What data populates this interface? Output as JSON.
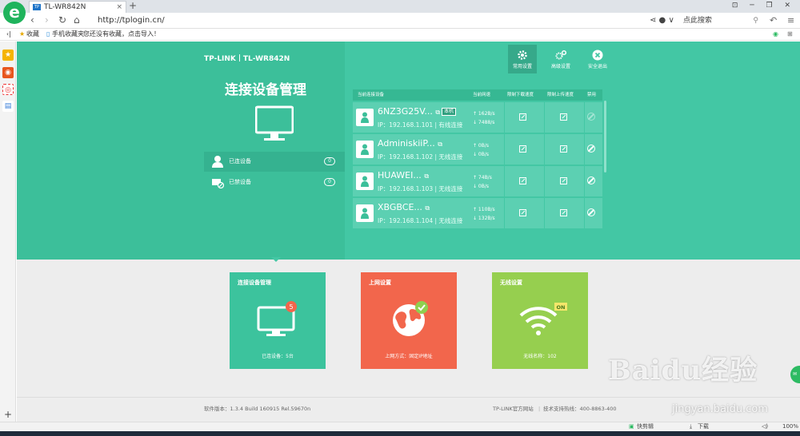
{
  "browser": {
    "tab_title": "TL-WR842N",
    "tab_favicon": "TP",
    "url": "http://tplogin.cn/",
    "search_placeholder": "点此搜索",
    "bookmarks": {
      "favorites": "收藏",
      "mobile": "手机收藏夹",
      "import_hint": "您还没有收藏，点击导入！"
    }
  },
  "router": {
    "brand": "TP-LINK",
    "model": "TL-WR842N",
    "page_title": "连接设备管理",
    "top_nav": [
      {
        "label": "常用设置",
        "icon": "gear-icon"
      },
      {
        "label": "高级设置",
        "icon": "gears-icon"
      },
      {
        "label": "安全退出",
        "icon": "exit-icon"
      }
    ],
    "menu": [
      {
        "label": "已连设备",
        "count": "0"
      },
      {
        "label": "已禁设备",
        "count": "0"
      }
    ],
    "table": {
      "headers": [
        "当前连接设备",
        "当前网速",
        "限制下载速度",
        "限制上传速度",
        "禁用"
      ],
      "rows": [
        {
          "name": "6NZ3G25V...",
          "badge": "本机",
          "ip": "IP：192.168.1.101 | 有线连接",
          "up": "↑ 162B/s",
          "down": "↓ 7488/s"
        },
        {
          "name": "AdminiskiiP...",
          "badge": "",
          "ip": "IP：192.168.1.102 | 无线连接",
          "up": "↑ 0B/s",
          "down": "↓ 0B/s"
        },
        {
          "name": "HUAWEI...",
          "badge": "",
          "ip": "IP：192.168.1.103 | 无线连接",
          "up": "↑ 74B/s",
          "down": "↓ 0B/s"
        },
        {
          "name": "XBGBCE...",
          "badge": "",
          "ip": "IP：192.168.1.104 | 无线连接",
          "up": "↑ 110B/s",
          "down": "↓ 132B/s"
        }
      ]
    },
    "cards": [
      {
        "title": "连接设备管理",
        "footer": "已连设备：5台",
        "badge": "5",
        "color": "#3cc39d"
      },
      {
        "title": "上网设置",
        "footer": "上网方式：固定IP地址",
        "color": "#f2664c"
      },
      {
        "title": "无线设置",
        "footer": "无线名称：102",
        "badge": "ON",
        "color": "#96cf4f"
      }
    ],
    "footer": {
      "version": "软件版本：1.3.4 Build 160915 Rel.59670n",
      "site": "TP-LINK官方网站",
      "hotline": "技术支持热线：400-8863-400"
    }
  },
  "statusbar": {
    "clip": "快剪辑",
    "download": "下载",
    "zoom": "100%"
  },
  "watermark": {
    "text": "Baidu经验",
    "url": "jingyan.baidu.com"
  }
}
